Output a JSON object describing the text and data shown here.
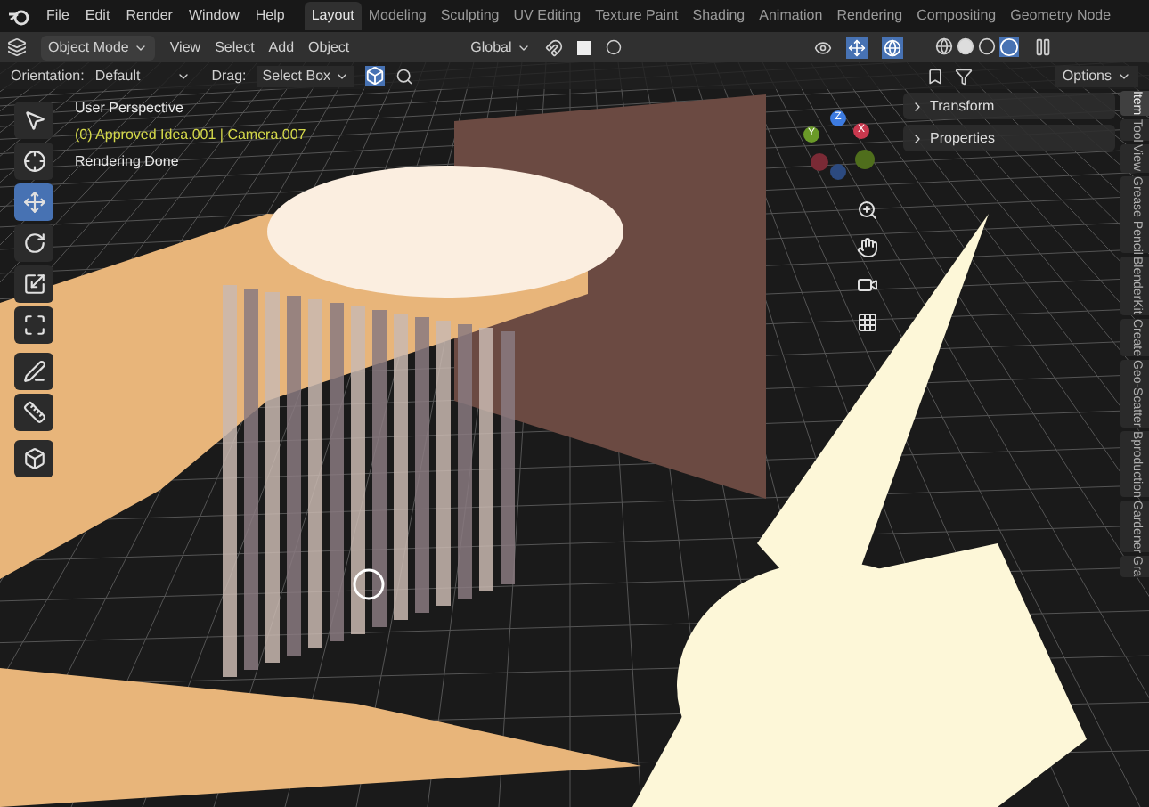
{
  "menu": [
    "File",
    "Edit",
    "Render",
    "Window",
    "Help"
  ],
  "workspaces": [
    {
      "label": "Layout",
      "selected": true
    },
    {
      "label": "Modeling",
      "selected": false
    },
    {
      "label": "Sculpting",
      "selected": false
    },
    {
      "label": "UV Editing",
      "selected": false
    },
    {
      "label": "Texture Paint",
      "selected": false
    },
    {
      "label": "Shading",
      "selected": false
    },
    {
      "label": "Animation",
      "selected": false
    },
    {
      "label": "Rendering",
      "selected": false
    },
    {
      "label": "Compositing",
      "selected": false
    },
    {
      "label": "Geometry Node",
      "selected": false
    }
  ],
  "header": {
    "mode": "Object Mode",
    "menus": [
      "View",
      "Select",
      "Add",
      "Object"
    ],
    "transform": "Global"
  },
  "tool_settings": {
    "orientation_label": "Orientation:",
    "orientation": "Default",
    "drag_label": "Drag:",
    "drag": "Select Box",
    "options": "Options"
  },
  "viewport_info": {
    "view": "User Perspective",
    "active": "(0) Approved Idea.001 | Camera.007",
    "status": "Rendering Done"
  },
  "tools": [
    {
      "kind": "select",
      "selected": false
    },
    {
      "kind": "cursor",
      "selected": false
    },
    {
      "kind": "move",
      "selected": true
    },
    {
      "kind": "rotate",
      "selected": false
    },
    {
      "kind": "scale",
      "selected": false
    },
    {
      "kind": "transform",
      "selected": false
    },
    {
      "kind": "annotate",
      "selected": false
    },
    {
      "kind": "measure",
      "selected": false
    },
    {
      "kind": "add_cube",
      "selected": false
    }
  ],
  "gizmo": {
    "x": "X",
    "y": "Y",
    "z": "Z"
  },
  "sidebar_panels": [
    {
      "title": "Transform",
      "expanded": false
    },
    {
      "title": "Properties",
      "expanded": false
    }
  ],
  "side_tabs": [
    {
      "label": "Item",
      "selected": true
    },
    {
      "label": "Tool",
      "selected": false
    },
    {
      "label": "View",
      "selected": false
    },
    {
      "label": "Grease Pencil",
      "selected": false
    },
    {
      "label": "BlenderKit",
      "selected": false
    },
    {
      "label": "Create",
      "selected": false
    },
    {
      "label": "Geo-Scatter",
      "selected": false
    },
    {
      "label": "Bproduction",
      "selected": false
    },
    {
      "label": "Gardener",
      "selected": false
    },
    {
      "label": "Gra",
      "selected": false
    }
  ]
}
